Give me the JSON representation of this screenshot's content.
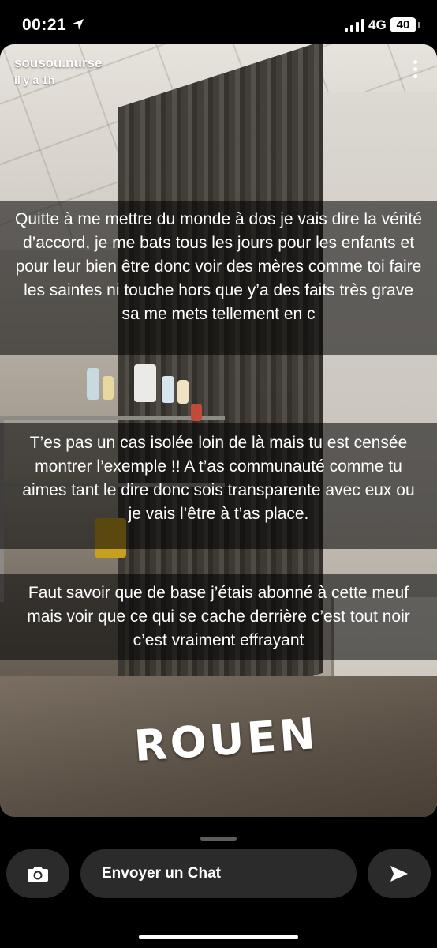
{
  "status_bar": {
    "time": "00:21",
    "network": "4G",
    "battery": "40"
  },
  "story": {
    "username": "sousou.nurse",
    "age": "il y a 1h",
    "captions": [
      "Quitte à me mettre du monde à dos je vais dire la vérité d’accord, je me bats tous les jours pour les enfants et pour leur bien être donc voir des mères comme toi faire les saintes ni touche hors que y’a des faits très grave sa me mets tellement en c",
      "T’es pas un cas isolée loin de là mais tu est censée montrer l’exemple !! A t’as communauté comme tu aimes tant le dire donc sois transparente avec eux ou je vais l’être à t’as place.",
      "Faut savoir que de base j’étais abonné à cette meuf mais voir que ce qui se cache derrière c’est tout noir c’est vraiment effrayant"
    ],
    "sticker": "ROUEN"
  },
  "reply_bar": {
    "placeholder": "Envoyer un Chat"
  },
  "icons": [
    "location-arrow-icon",
    "signal-icon",
    "battery-icon",
    "more-icon",
    "camera-icon",
    "send-icon"
  ]
}
